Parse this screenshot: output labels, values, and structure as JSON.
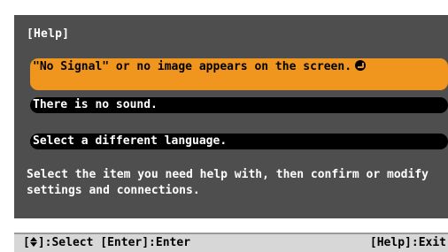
{
  "dialog": {
    "title": "[Help]",
    "items": [
      {
        "label": "\"No Signal\" or no image appears on the screen.",
        "selected": true
      },
      {
        "label": "There is no sound.",
        "selected": false
      },
      {
        "label": "Select a different language.",
        "selected": false
      }
    ],
    "instructions": "Select the item you need help with, then confirm or modify\nsettings and connections."
  },
  "statusbar": {
    "select_prefix": "[",
    "select_suffix": "]:Select [Enter]:Enter",
    "exit": "[Help]:Exit",
    "updown_icon": "up-down-arrow-icon",
    "enter_icon": "enter-icon"
  },
  "colors": {
    "panel_bg": "#4e4e4e",
    "selected_bg": "#f0961e",
    "item_bg": "#000000",
    "statusbar_bg": "#d7d7d7"
  }
}
